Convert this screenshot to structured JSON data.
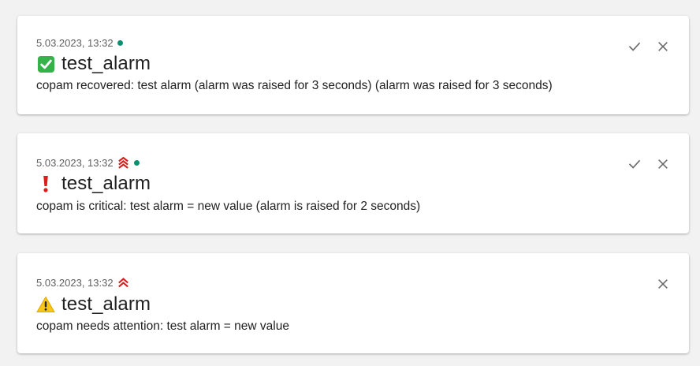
{
  "colors": {
    "online_dot": "#0a8f6f",
    "priority_red": "#d32020",
    "action_icon": "#6b6b6b",
    "recovered_green": "#36b24a",
    "critical_red": "#e01b1b",
    "warning_yellow": "#f6c61a"
  },
  "notifications": [
    {
      "timestamp": "5.03.2023, 13:32",
      "status_icon": "check-mark-button-icon",
      "priority": "none",
      "online": true,
      "title": "test_alarm",
      "message": "copam recovered: test alarm (alarm was raised for 3 seconds) (alarm was raised for 3 seconds)",
      "actions": [
        "acknowledge",
        "dismiss"
      ]
    },
    {
      "timestamp": "5.03.2023, 13:32",
      "status_icon": "exclamation-icon",
      "priority": "max",
      "online": true,
      "title": "test_alarm",
      "message": "copam is critical: test alarm = new value (alarm is raised for 2 seconds)",
      "actions": [
        "acknowledge",
        "dismiss"
      ]
    },
    {
      "timestamp": "5.03.2023, 13:32",
      "status_icon": "warning-icon",
      "priority": "high",
      "online": false,
      "title": "test_alarm",
      "message": "copam needs attention: test alarm = new value",
      "actions": [
        "dismiss"
      ]
    }
  ]
}
